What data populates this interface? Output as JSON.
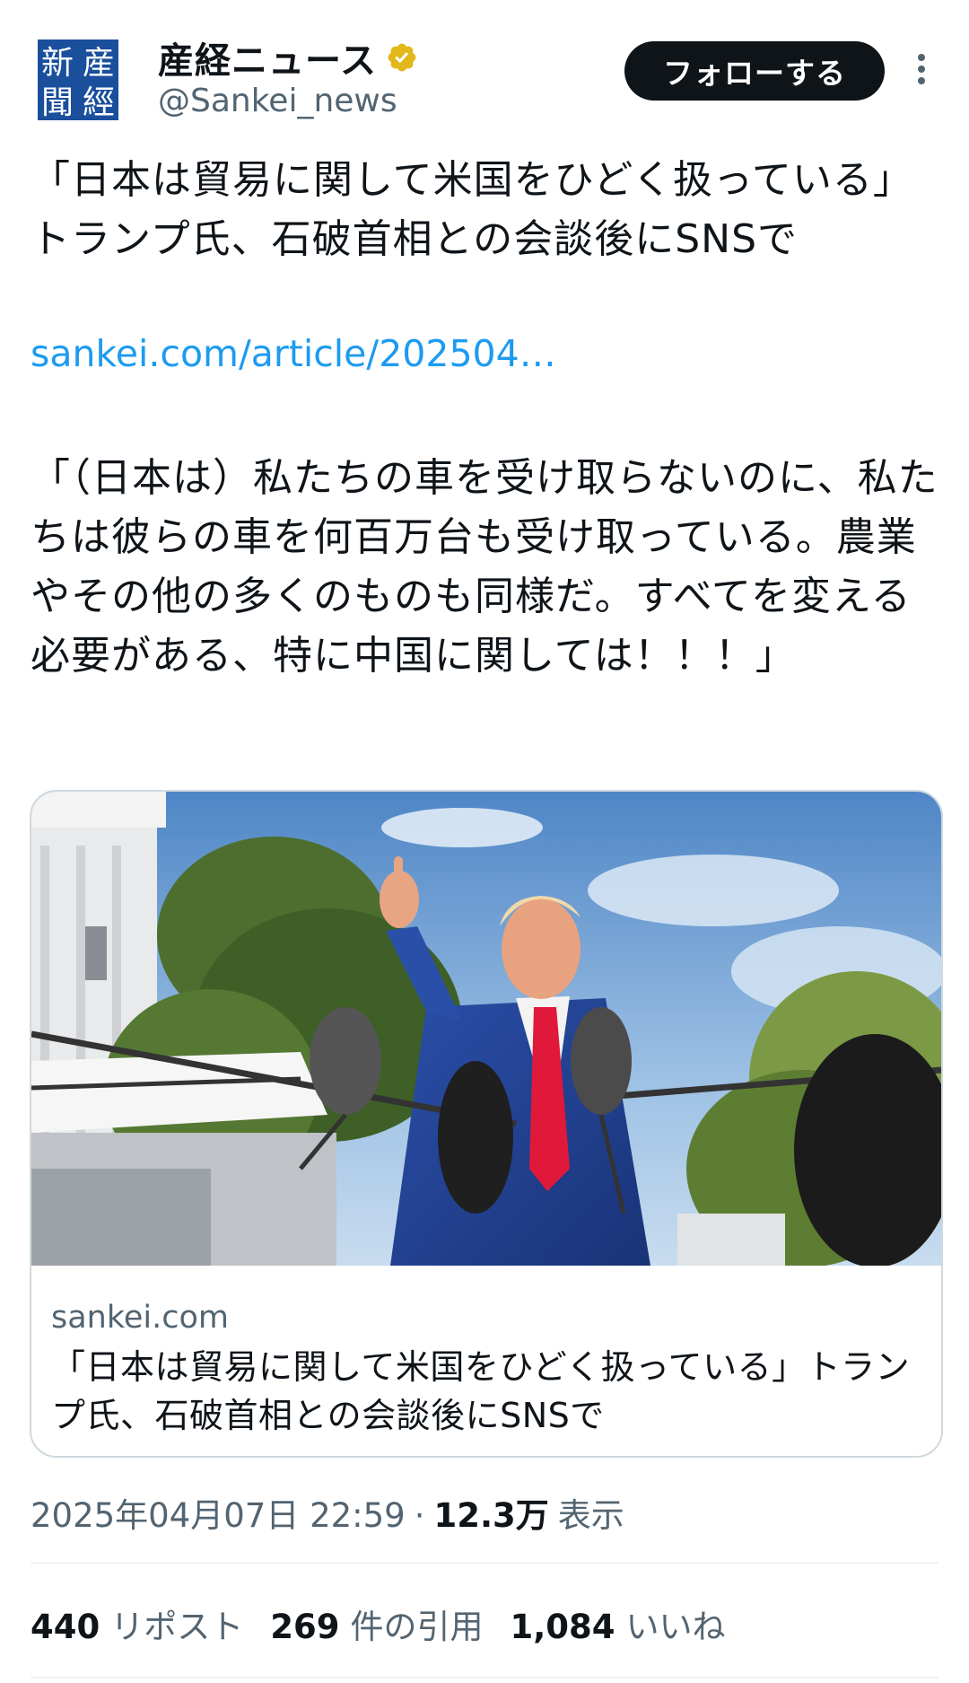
{
  "header": {
    "avatar_chars": [
      "新",
      "聞",
      "産",
      "經"
    ],
    "display_name": "産経ニュース",
    "verified_icon": "verified-badge-gold",
    "handle": "@Sankei_news",
    "follow_label": "フォローする",
    "more_icon": "more-vertical-icon"
  },
  "tweet": {
    "text": "「日本は貿易に関して米国をひどく扱っている」トランプ氏、石破首相との会談後にSNSで",
    "link": "sankei.com/article/202504…",
    "quote": "「（日本は）私たちの車を受け取らないのに、私たちは彼らの車を何百万台も受け取っている。農業やその他の多くのものも同様だ。すべてを変える必要がある、特に中国に関しては！！！」"
  },
  "card": {
    "domain": "sankei.com",
    "title": "「日本は貿易に関して米国をひどく扱っている」トランプ氏、石破首相との会談後にSNSで"
  },
  "meta": {
    "timestamp": "2025年04月07日 22:59",
    "separator": "·",
    "views": "12.3万",
    "views_label": "表示"
  },
  "stats": {
    "reposts_count": "440",
    "reposts_label": "リポスト",
    "quotes_count": "269",
    "quotes_label": "件の引用",
    "likes_count": "1,084",
    "likes_label": "いいね"
  },
  "colors": {
    "text": "#0f1419",
    "secondary": "#536471",
    "link": "#1d9bf0",
    "verified": "#e2b719",
    "avatar_blue": "#1a4f9c"
  }
}
